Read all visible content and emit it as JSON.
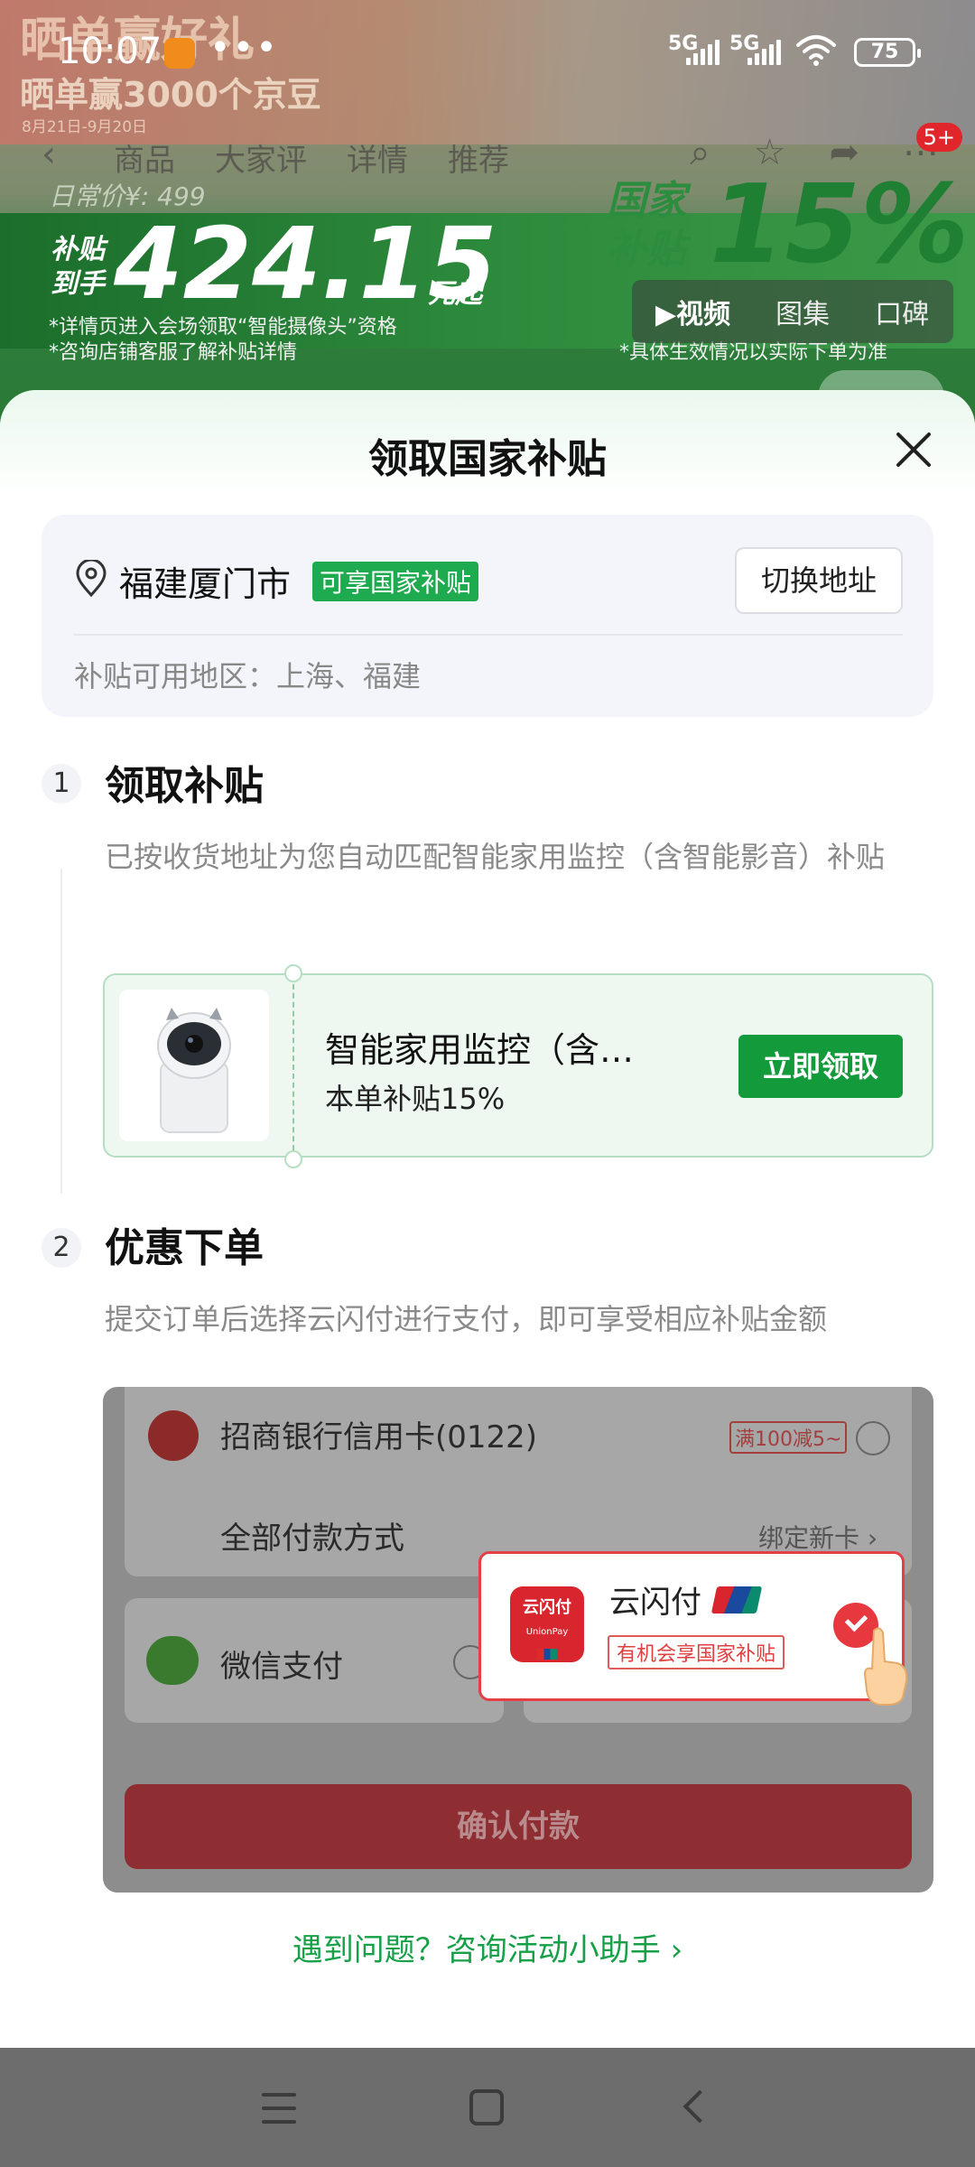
{
  "status_bar": {
    "time": "10:07",
    "dots": "•••",
    "signal1": "5G",
    "signal2": "5G",
    "battery": "75"
  },
  "background": {
    "promo_title": "晒单赢好礼",
    "promo_sub": "晒单赢3000个京豆",
    "promo_date": "8月21日-9月20日",
    "tabs": [
      "商品",
      "大家评",
      "详情",
      "推荐"
    ],
    "badge": "5+",
    "daily_price": "日常价¥: 499",
    "subsidy_label": "补贴到手",
    "price": "424.15",
    "price_unit": "元起",
    "national_label": "国家补贴",
    "percent": "15%",
    "note1": "*详情页进入会场领取“智能摄像头”资格",
    "note2": "*咨询店铺客服了解补贴详情",
    "note3": "*具体生效情况以实际下单为准",
    "media_tabs": [
      "▶视频",
      "图集",
      "口碑"
    ]
  },
  "sheet": {
    "title": "领取国家补贴",
    "address": {
      "city": "福建厦门市",
      "tag": "可享国家补贴",
      "switch_label": "切换地址",
      "regions": "补贴可用地区：上海、福建"
    },
    "step1": {
      "num": "1",
      "title": "领取补贴",
      "desc": "已按收货地址为您自动匹配智能家用监控（含智能影音）补贴",
      "coupon": {
        "name": "智能家用监控（含…",
        "rate": "本单补贴15%",
        "claim_label": "立即领取"
      }
    },
    "step2": {
      "num": "2",
      "title": "优惠下单",
      "desc": "提交订单后选择云闪付进行支付，即可享受相应补贴金额"
    },
    "payment": {
      "bank": "招商银行信用卡(0122)",
      "promo": "满100减5~",
      "all_methods": "全部付款方式",
      "bind_card": "绑定新卡 ›",
      "wechat": "微信支付",
      "confirm": "确认付款",
      "unionpay_logo": "云闪付",
      "unionpay_logo_sub": "UnionPay",
      "unionpay_name": "云闪付",
      "unionpay_note": "有机会享国家补贴"
    },
    "help_link": "遇到问题？咨询活动小助手 ›"
  },
  "colors": {
    "accent_green": "#139a3a",
    "tag_green": "#1eaa4e",
    "link_green": "#17a048",
    "unionpay_red": "#e8383f"
  }
}
